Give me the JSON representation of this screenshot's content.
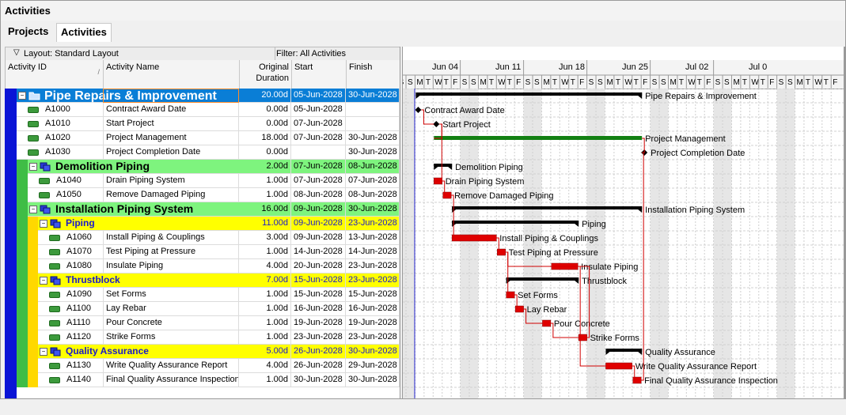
{
  "window": {
    "title": "Activities"
  },
  "tabs": [
    {
      "label": "Projects"
    },
    {
      "label": "Activities"
    }
  ],
  "toolbar": {
    "layout_label": "Layout: Standard Layout",
    "filter_label": "Filter: All Activities"
  },
  "columns": {
    "activity_id": "Activity ID",
    "activity_name": "Activity Name",
    "duration_1": "Original",
    "duration_2": "Duration",
    "start": "Start",
    "finish": "Finish"
  },
  "timeline": {
    "months": [
      "Jun 04",
      "Jun 11",
      "Jun 18",
      "Jun 25",
      "Jul 02",
      "Jul 0"
    ],
    "day_letters": [
      "S",
      "M",
      "T",
      "W",
      "T",
      "F",
      "S"
    ]
  },
  "colors": {
    "project_row": "#0a7ed6",
    "wbs1_row": "#7ef47e",
    "wbs2_row": "#ffff00",
    "critical_bar": "#e00000",
    "normal_bar": "#128012",
    "summary_bar": "#000000"
  },
  "rows": [
    {
      "type": "project",
      "id": "",
      "name": "Pipe Repairs & Improvement",
      "dur": "20.00d",
      "start": "05-Jun-2028",
      "finish": "30-Jun-2028",
      "bar": {
        "kind": "summary",
        "s": 1,
        "f": 26
      },
      "label": "Pipe Repairs & Improvement"
    },
    {
      "type": "act",
      "id": "A1000",
      "name": "Contract Award Date",
      "dur": "0.00d",
      "start": "05-Jun-2028",
      "finish": "",
      "bar": {
        "kind": "milestone",
        "s": 1
      },
      "label": "Contract Award Date"
    },
    {
      "type": "act",
      "id": "A1010",
      "name": "Start Project",
      "dur": "0.00d",
      "start": "07-Jun-2028",
      "finish": "",
      "bar": {
        "kind": "milestone",
        "s": 3
      },
      "label": "Start Project"
    },
    {
      "type": "act",
      "id": "A1020",
      "name": "Project Management",
      "dur": "18.00d",
      "start": "07-Jun-2028",
      "finish": "30-Jun-2028",
      "bar": {
        "kind": "normal",
        "s": 3,
        "f": 26
      },
      "label": "Project Management"
    },
    {
      "type": "act",
      "id": "A1030",
      "name": "Project Completion Date",
      "dur": "0.00d",
      "start": "",
      "finish": "30-Jun-2028",
      "bar": {
        "kind": "milestone",
        "s": 26
      },
      "label": "Project Completion Date"
    },
    {
      "type": "wbs1",
      "id": "",
      "name": "Demolition Piping",
      "dur": "2.00d",
      "start": "07-Jun-2028",
      "finish": "08-Jun-2028",
      "bar": {
        "kind": "summary",
        "s": 3,
        "f": 5
      },
      "label": "Demolition Piping"
    },
    {
      "type": "act",
      "id": "A1040",
      "name": "Drain Piping System",
      "dur": "1.00d",
      "start": "07-Jun-2028",
      "finish": "07-Jun-2028",
      "bar": {
        "kind": "critical",
        "s": 3,
        "f": 4
      },
      "label": "Drain Piping System"
    },
    {
      "type": "act",
      "id": "A1050",
      "name": "Remove Damaged Piping",
      "dur": "1.00d",
      "start": "08-Jun-2028",
      "finish": "08-Jun-2028",
      "bar": {
        "kind": "critical",
        "s": 4,
        "f": 5
      },
      "label": "Remove Damaged Piping"
    },
    {
      "type": "wbs1",
      "id": "",
      "name": "Installation Piping System",
      "dur": "16.00d",
      "start": "09-Jun-2028",
      "finish": "30-Jun-2028",
      "bar": {
        "kind": "summary",
        "s": 5,
        "f": 26
      },
      "label": "Installation Piping System"
    },
    {
      "type": "wbs2",
      "id": "",
      "name": "Piping",
      "dur": "11.00d",
      "start": "09-Jun-2028",
      "finish": "23-Jun-2028",
      "bar": {
        "kind": "summary",
        "s": 5,
        "f": 19
      },
      "label": "Piping"
    },
    {
      "type": "act",
      "id": "A1060",
      "name": "Install Piping & Couplings",
      "dur": "3.00d",
      "start": "09-Jun-2028",
      "finish": "13-Jun-2028",
      "bar": {
        "kind": "critical",
        "s": 5,
        "f": 10
      },
      "label": "Install Piping & Couplings"
    },
    {
      "type": "act",
      "id": "A1070",
      "name": "Test Piping at Pressure",
      "dur": "1.00d",
      "start": "14-Jun-2028",
      "finish": "14-Jun-2028",
      "bar": {
        "kind": "critical",
        "s": 10,
        "f": 11
      },
      "label": "Test Piping at Pressure"
    },
    {
      "type": "act",
      "id": "A1080",
      "name": "Insulate Piping",
      "dur": "4.00d",
      "start": "20-Jun-2028",
      "finish": "23-Jun-2028",
      "bar": {
        "kind": "critical",
        "s": 16,
        "f": 19
      },
      "label": "Insulate Piping"
    },
    {
      "type": "wbs2",
      "id": "",
      "name": "Thrustblock",
      "dur": "7.00d",
      "start": "15-Jun-2028",
      "finish": "23-Jun-2028",
      "bar": {
        "kind": "summary",
        "s": 11,
        "f": 19
      },
      "label": "Thrustblock"
    },
    {
      "type": "act",
      "id": "A1090",
      "name": "Set Forms",
      "dur": "1.00d",
      "start": "15-Jun-2028",
      "finish": "15-Jun-2028",
      "bar": {
        "kind": "critical",
        "s": 11,
        "f": 12
      },
      "label": "Set Forms"
    },
    {
      "type": "act",
      "id": "A1100",
      "name": "Lay Rebar",
      "dur": "1.00d",
      "start": "16-Jun-2028",
      "finish": "16-Jun-2028",
      "bar": {
        "kind": "critical",
        "s": 12,
        "f": 13
      },
      "label": "Lay Rebar"
    },
    {
      "type": "act",
      "id": "A1110",
      "name": "Pour Concrete",
      "dur": "1.00d",
      "start": "19-Jun-2028",
      "finish": "19-Jun-2028",
      "bar": {
        "kind": "critical",
        "s": 15,
        "f": 16
      },
      "label": "Pour Concrete"
    },
    {
      "type": "act",
      "id": "A1120",
      "name": "Strike Forms",
      "dur": "1.00d",
      "start": "23-Jun-2028",
      "finish": "23-Jun-2028",
      "bar": {
        "kind": "critical",
        "s": 19,
        "f": 20
      },
      "label": "Strike Forms"
    },
    {
      "type": "wbs2",
      "id": "",
      "name": "Quality Assurance",
      "dur": "5.00d",
      "start": "26-Jun-2028",
      "finish": "30-Jun-2028",
      "bar": {
        "kind": "summary",
        "s": 22,
        "f": 26
      },
      "label": "Quality Assurance"
    },
    {
      "type": "act",
      "id": "A1130",
      "name": "Write Quality Assurance Report",
      "dur": "4.00d",
      "start": "26-Jun-2028",
      "finish": "29-Jun-2028",
      "bar": {
        "kind": "critical",
        "s": 22,
        "f": 25
      },
      "label": "Write Quality Assurance Report"
    },
    {
      "type": "act",
      "id": "A1140",
      "name": "Final Quality Assurance Inspection",
      "dur": "1.00d",
      "start": "30-Jun-2028",
      "finish": "30-Jun-2028",
      "bar": {
        "kind": "critical",
        "s": 25,
        "f": 26
      },
      "label": "Final Quality Assurance Inspection"
    }
  ]
}
